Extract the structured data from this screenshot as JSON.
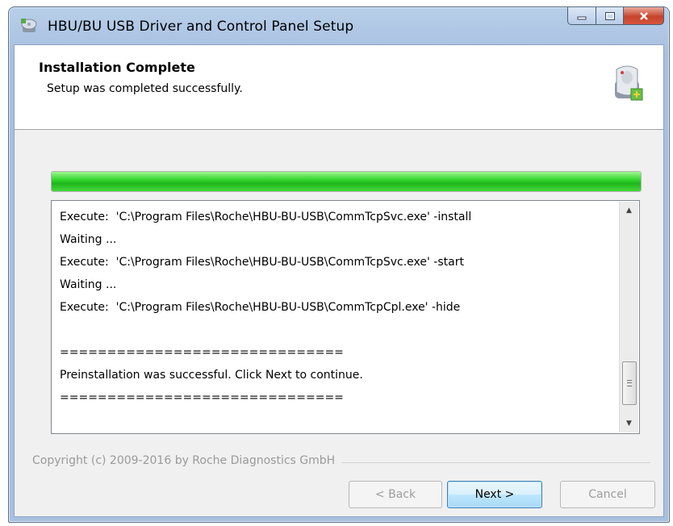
{
  "window": {
    "title": "HBU/BU USB Driver and Control Panel Setup",
    "icon": "setup-cd-icon",
    "controls": {
      "minimize": "minimize-icon",
      "maximize": "maximize-icon",
      "close": "close-icon"
    }
  },
  "header": {
    "title": "Installation Complete",
    "subtitle": "Setup was completed successfully.",
    "icon": "disk-install-icon"
  },
  "progress": {
    "value": 1.0,
    "color": "#2fd12a"
  },
  "log": {
    "lines": [
      "Execute:  'C:\\Program Files\\Roche\\HBU-BU-USB\\CommTcpSvc.exe' -install",
      "Waiting ...",
      "Execute:  'C:\\Program Files\\Roche\\HBU-BU-USB\\CommTcpSvc.exe' -start",
      "Waiting ...",
      "Execute:  'C:\\Program Files\\Roche\\HBU-BU-USB\\CommTcpCpl.exe' -hide",
      "",
      "==============================",
      "Preinstallation was successful. Click Next to continue.",
      "=============================="
    ]
  },
  "footer": {
    "copyright": "Copyright (c) 2009-2016 by Roche Diagnostics GmbH"
  },
  "buttons": {
    "back": "< Back",
    "next": "Next >",
    "cancel": "Cancel"
  }
}
